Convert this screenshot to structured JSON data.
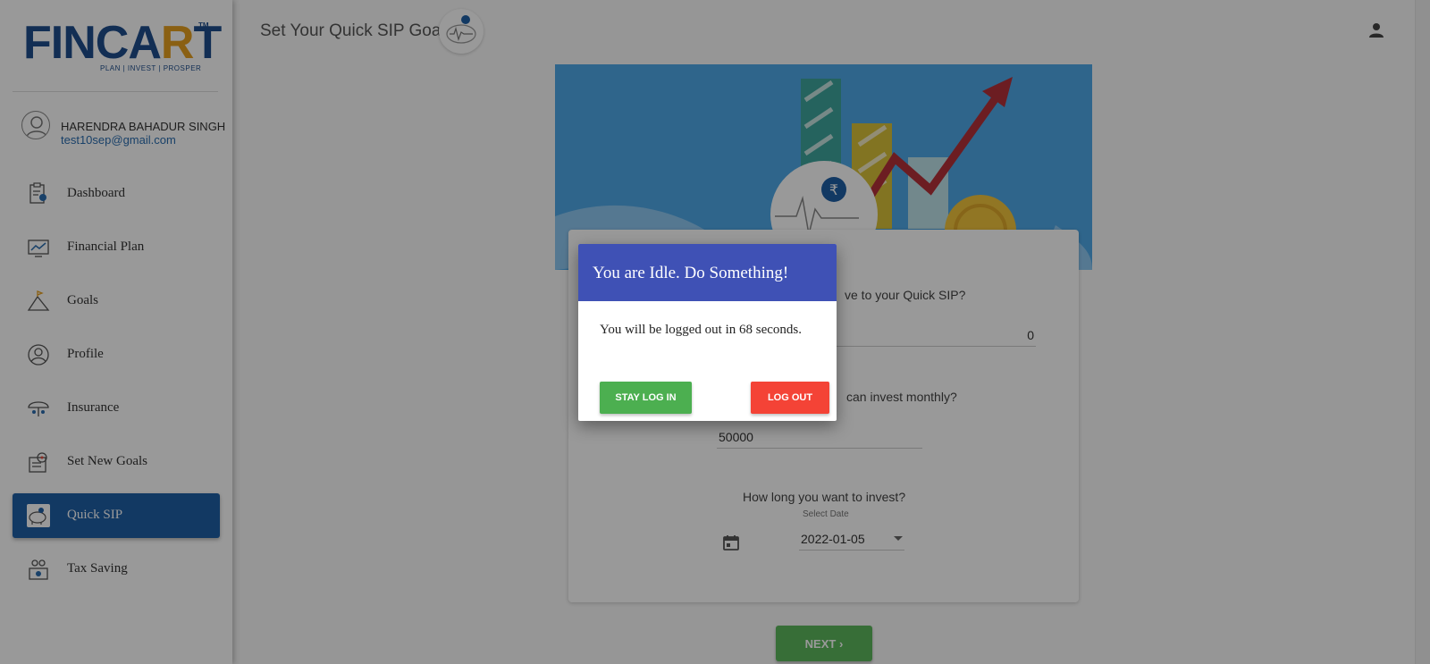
{
  "brand": {
    "logo_text_pre": "FINCA",
    "logo_text_r": "R",
    "logo_text_post": "T",
    "logo_tm": "TM",
    "tagline": "PLAN | INVEST | PROSPER"
  },
  "user": {
    "name": "HARENDRA BAHADUR SINGH",
    "email": "test10sep@gmail.com"
  },
  "sidebar": {
    "items": [
      {
        "label": "Dashboard",
        "icon": "dashboard-icon"
      },
      {
        "label": "Financial Plan",
        "icon": "chart-icon"
      },
      {
        "label": "Goals",
        "icon": "mountain-flag-icon"
      },
      {
        "label": "Profile",
        "icon": "profile-icon"
      },
      {
        "label": "Insurance",
        "icon": "umbrella-family-icon"
      },
      {
        "label": "Set New Goals",
        "icon": "target-icon"
      },
      {
        "label": "Quick SIP",
        "icon": "piggy-bank-icon",
        "active": true
      },
      {
        "label": "Tax Saving",
        "icon": "tax-icon"
      }
    ]
  },
  "header": {
    "title": "Set Your Quick SIP Goal",
    "user_menu_icon": "person-icon"
  },
  "form": {
    "q1_visible": "ve to your Quick SIP?",
    "field1_value": "0",
    "q2_visible": "can invest monthly?",
    "field2_value": "50000",
    "q3": "How long you want to invest?",
    "date_caption": "Select Date",
    "date_value": "2022-01-05",
    "next_label": "NEXT"
  },
  "dialog": {
    "title": "You are Idle. Do Something!",
    "message": "You will be logged out in 68 seconds.",
    "stay_label": "STAY LOG IN",
    "logout_label": "LOG OUT"
  },
  "colors": {
    "primary": "#1f5fa6",
    "dialog_header": "#3f51b5",
    "stay_button": "#4caf50",
    "logout_button": "#f44336",
    "next_button": "#5cb85c",
    "hero_blue": "#4fa9e8"
  }
}
